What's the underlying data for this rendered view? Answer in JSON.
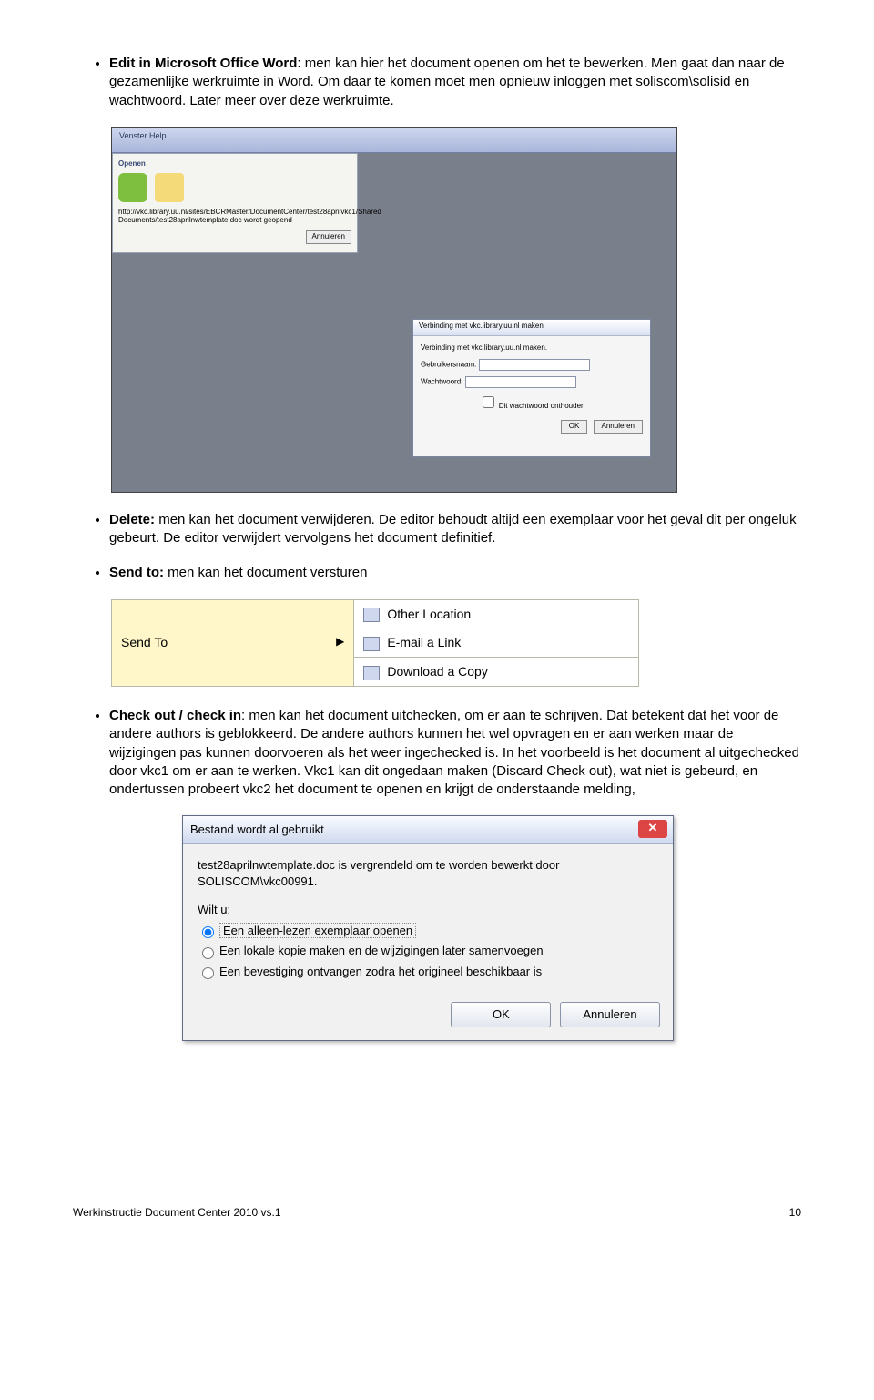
{
  "bullets": {
    "edit_label": "Edit in Microsoft Office Word",
    "edit_text": ": men kan hier het document openen om het te bewerken. Men gaat dan naar de gezamenlijke werkruimte in Word. Om daar te komen moet men opnieuw inloggen met soliscom\\solisid en wachtwoord. Later meer over deze werkruimte.",
    "delete_label": "Delete:",
    "delete_text": " men kan het document verwijderen. De editor behoudt altijd een exemplaar voor het geval dit per ongeluk gebeurt. De editor verwijdert vervolgens het document definitief.",
    "sendto_label": "Send to:",
    "sendto_text": " men kan het document versturen",
    "check_label": "Check out / check in",
    "check_text": ": men kan het document uitchecken, om er aan te schrijven. Dat betekent dat het voor de andere authors is geblokkeerd. De andere authors kunnen het wel opvragen en er aan werken maar de wijzigingen pas kunnen doorvoeren als het weer ingechecked is. In het voorbeeld is het document al uitgechecked door vkc1 om er aan te werken. Vkc1 kan dit ongedaan maken (Discard Check out), wat niet is gebeurd, en ondertussen probeert vkc2 het document te openen en krijgt de onderstaande melding,"
  },
  "fig1": {
    "menu_items": "Venster  Help",
    "open_title": "Openen",
    "open_url": "http://vkc.library.uu.nl/sites/EBCRMaster/DocumentCenter/test28aprilvkc1/Shared Documents/test28aprilnwtemplate.doc wordt geopend",
    "open_cancel": "Annuleren",
    "login_title": "Verbinding met vkc.library.uu.nl maken",
    "login_sub": "Verbinding met vkc.library.uu.nl maken.",
    "login_user": "Gebruikersnaam:",
    "login_pass": "Wachtwoord:",
    "login_remember": "Dit wachtwoord onthouden",
    "ok": "OK",
    "cancel": "Annuleren"
  },
  "sendto_menu": {
    "left": "Send To",
    "r1": "Other Location",
    "r2": "E-mail a Link",
    "r3": "Download a Copy"
  },
  "dialog": {
    "title": "Bestand wordt al gebruikt",
    "msg": "test28aprilnwtemplate.doc is vergrendeld om te worden bewerkt door SOLISCOM\\vkc00991.",
    "wilt": "Wilt u:",
    "o1": "Een alleen-lezen exemplaar openen",
    "o2": "Een lokale kopie maken en de wijzigingen later samenvoegen",
    "o3": "Een bevestiging ontvangen zodra het origineel beschikbaar is",
    "ok": "OK",
    "cancel": "Annuleren"
  },
  "footer": {
    "left": "Werkinstructie Document Center 2010 vs.1",
    "page": "10"
  }
}
